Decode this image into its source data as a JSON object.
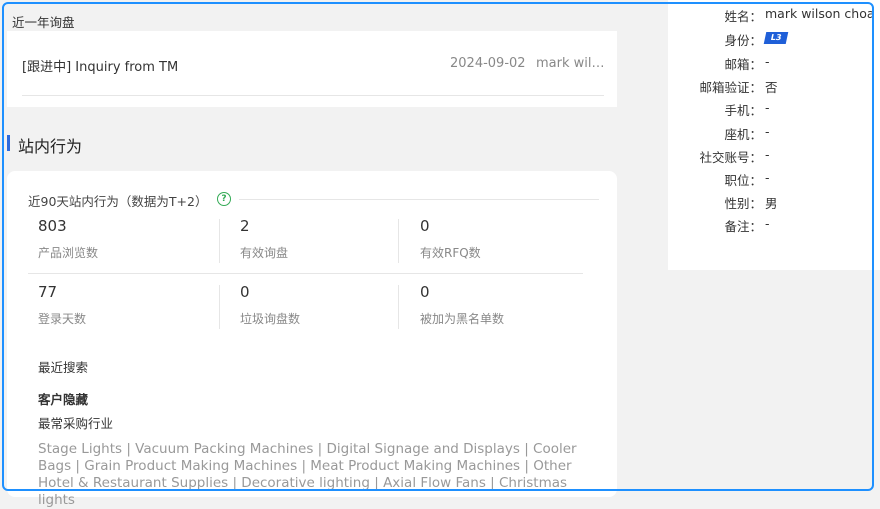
{
  "recent_inquiries": {
    "title": "近一年询盘",
    "item": {
      "status": "[跟进中]",
      "subject": "Inquiry from TM",
      "date": "2024-09-02",
      "contact": "mark wilson"
    }
  },
  "onsite_behavior": {
    "title": "站内行为",
    "subtitle": "近90天站内行为（数据为T+2）",
    "stats": [
      {
        "value": "803",
        "label": "产品浏览数"
      },
      {
        "value": "2",
        "label": "有效询盘"
      },
      {
        "value": "0",
        "label": "有效RFQ数"
      },
      {
        "value": "77",
        "label": "登录天数"
      },
      {
        "value": "0",
        "label": "垃圾询盘数"
      },
      {
        "value": "0",
        "label": "被加为黑名单数"
      }
    ],
    "recent_search_label": "最近搜索",
    "hidden_label": "客户隐藏",
    "industry_label": "最常采购行业",
    "industries": "Stage Lights | Vacuum Packing Machines | Digital Signage and Displays | Cooler Bags | Grain Product Making Machines | Meat Product Making Machines | Other Hotel & Restaurant Supplies | Decorative lighting | Axial Flow Fans | Christmas lights"
  },
  "profile": {
    "rows": [
      {
        "key": "姓名：",
        "value": "mark wilson choa"
      },
      {
        "key": "身份：",
        "value": "L3"
      },
      {
        "key": "邮箱：",
        "value": "-"
      },
      {
        "key": "邮箱验证：",
        "value": "否"
      },
      {
        "key": "手机：",
        "value": "-"
      },
      {
        "key": "座机：",
        "value": "-"
      },
      {
        "key": "社交账号：",
        "value": "-"
      },
      {
        "key": "职位：",
        "value": "-"
      },
      {
        "key": "性别：",
        "value": "男"
      },
      {
        "key": "备注：",
        "value": "-"
      }
    ],
    "badge_color": "#1f5fd8"
  },
  "colors": {
    "accent": "#2f6bdc",
    "frame": "#1e90ff",
    "help": "#33aa55"
  },
  "icons": {
    "help": "question-circle-icon"
  },
  "help_glyph": "?"
}
